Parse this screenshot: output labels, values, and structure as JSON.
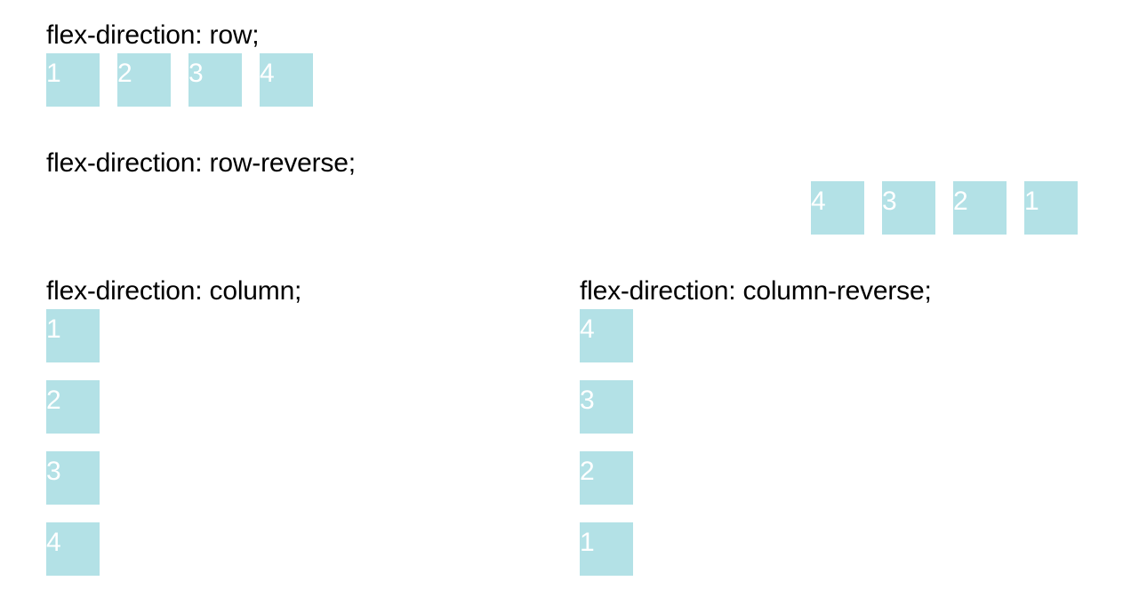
{
  "demos": {
    "row": {
      "label": "flex-direction: row;",
      "items": [
        "1",
        "2",
        "3",
        "4"
      ]
    },
    "row_reverse": {
      "label": "flex-direction: row-reverse;",
      "items": [
        "1",
        "2",
        "3",
        "4"
      ]
    },
    "column": {
      "label": "flex-direction: column;",
      "items": [
        "1",
        "2",
        "3",
        "4"
      ]
    },
    "column_reverse": {
      "label": "flex-direction: column-reverse;",
      "items": [
        "1",
        "2",
        "3",
        "4"
      ]
    }
  },
  "colors": {
    "box_background": "#b3e1e6",
    "box_text": "#ffffff",
    "label_text": "#000000",
    "page_background": "#ffffff"
  }
}
